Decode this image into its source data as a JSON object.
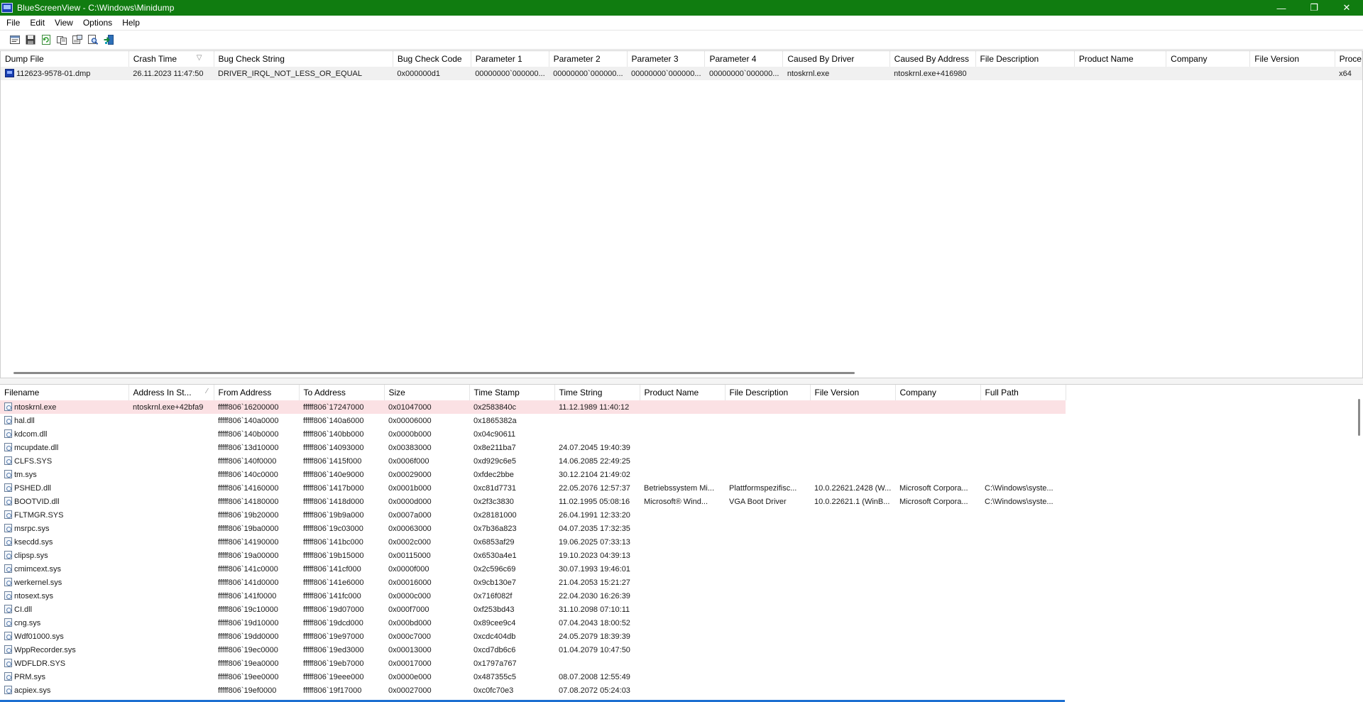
{
  "window": {
    "title": "BlueScreenView  -  C:\\Windows\\Minidump",
    "minimize": "—",
    "restore": "❐",
    "close": "✕"
  },
  "menu": [
    "File",
    "Edit",
    "View",
    "Options",
    "Help"
  ],
  "toolbar": {
    "icons": [
      "properties-icon",
      "save-icon",
      "refresh-icon",
      "copy-icon",
      "html-report-icon",
      "find-icon",
      "exit-icon"
    ]
  },
  "dumps": {
    "columns": [
      "Dump File",
      "Crash Time",
      "Bug Check String",
      "Bug Check Code",
      "Parameter 1",
      "Parameter 2",
      "Parameter 3",
      "Parameter 4",
      "Caused By Driver",
      "Caused By Address",
      "File Description",
      "Product Name",
      "Company",
      "File Version",
      "Proce"
    ],
    "sort_indicator": "▽",
    "rows": [
      [
        "112623-9578-01.dmp",
        "26.11.2023 11:47:50",
        "DRIVER_IRQL_NOT_LESS_OR_EQUAL",
        "0x000000d1",
        "00000000`000000...",
        "00000000`000000...",
        "00000000`000000...",
        "00000000`000000...",
        "ntoskrnl.exe",
        "ntoskrnl.exe+416980",
        "",
        "",
        "",
        "",
        "x64"
      ]
    ]
  },
  "modules": {
    "columns": [
      "Filename",
      "Address In St...",
      "From Address",
      "To Address",
      "Size",
      "Time Stamp",
      "Time String",
      "Product Name",
      "File Description",
      "File Version",
      "Company",
      "Full Path"
    ],
    "sort_indicator": "⁄",
    "rows": [
      [
        "ntoskrnl.exe",
        "ntoskrnl.exe+42bfa9",
        "fffff806`16200000",
        "fffff806`17247000",
        "0x01047000",
        "0x2583840c",
        "11.12.1989 11:40:12",
        "",
        "",
        "",
        "",
        ""
      ],
      [
        "hal.dll",
        "",
        "fffff806`140a0000",
        "fffff806`140a6000",
        "0x00006000",
        "0x1865382a",
        "",
        "",
        "",
        "",
        "",
        ""
      ],
      [
        "kdcom.dll",
        "",
        "fffff806`140b0000",
        "fffff806`140bb000",
        "0x0000b000",
        "0x04c90611",
        "",
        "",
        "",
        "",
        "",
        ""
      ],
      [
        "mcupdate.dll",
        "",
        "fffff806`13d10000",
        "fffff806`14093000",
        "0x00383000",
        "0x8e211ba7",
        "24.07.2045 19:40:39",
        "",
        "",
        "",
        "",
        ""
      ],
      [
        "CLFS.SYS",
        "",
        "fffff806`140f0000",
        "fffff806`1415f000",
        "0x0006f000",
        "0xd929c6e5",
        "14.06.2085 22:49:25",
        "",
        "",
        "",
        "",
        ""
      ],
      [
        "tm.sys",
        "",
        "fffff806`140c0000",
        "fffff806`140e9000",
        "0x00029000",
        "0xfdec2bbe",
        "30.12.2104 21:49:02",
        "",
        "",
        "",
        "",
        ""
      ],
      [
        "PSHED.dll",
        "",
        "fffff806`14160000",
        "fffff806`1417b000",
        "0x0001b000",
        "0xc81d7731",
        "22.05.2076 12:57:37",
        "Betriebssystem Mi...",
        "Plattformspezifisc...",
        "10.0.22621.2428 (W...",
        "Microsoft Corpora...",
        "C:\\Windows\\syste..."
      ],
      [
        "BOOTVID.dll",
        "",
        "fffff806`14180000",
        "fffff806`1418d000",
        "0x0000d000",
        "0x2f3c3830",
        "11.02.1995 05:08:16",
        "Microsoft® Wind...",
        "VGA Boot Driver",
        "10.0.22621.1 (WinB...",
        "Microsoft Corpora...",
        "C:\\Windows\\syste..."
      ],
      [
        "FLTMGR.SYS",
        "",
        "fffff806`19b20000",
        "fffff806`19b9a000",
        "0x0007a000",
        "0x28181000",
        "26.04.1991 12:33:20",
        "",
        "",
        "",
        "",
        ""
      ],
      [
        "msrpc.sys",
        "",
        "fffff806`19ba0000",
        "fffff806`19c03000",
        "0x00063000",
        "0x7b36a823",
        "04.07.2035 17:32:35",
        "",
        "",
        "",
        "",
        ""
      ],
      [
        "ksecdd.sys",
        "",
        "fffff806`14190000",
        "fffff806`141bc000",
        "0x0002c000",
        "0x6853af29",
        "19.06.2025 07:33:13",
        "",
        "",
        "",
        "",
        ""
      ],
      [
        "clipsp.sys",
        "",
        "fffff806`19a00000",
        "fffff806`19b15000",
        "0x00115000",
        "0x6530a4e1",
        "19.10.2023 04:39:13",
        "",
        "",
        "",
        "",
        ""
      ],
      [
        "cmimcext.sys",
        "",
        "fffff806`141c0000",
        "fffff806`141cf000",
        "0x0000f000",
        "0x2c596c69",
        "30.07.1993 19:46:01",
        "",
        "",
        "",
        "",
        ""
      ],
      [
        "werkernel.sys",
        "",
        "fffff806`141d0000",
        "fffff806`141e6000",
        "0x00016000",
        "0x9cb130e7",
        "21.04.2053 15:21:27",
        "",
        "",
        "",
        "",
        ""
      ],
      [
        "ntosext.sys",
        "",
        "fffff806`141f0000",
        "fffff806`141fc000",
        "0x0000c000",
        "0x716f082f",
        "22.04.2030 16:26:39",
        "",
        "",
        "",
        "",
        ""
      ],
      [
        "CI.dll",
        "",
        "fffff806`19c10000",
        "fffff806`19d07000",
        "0x000f7000",
        "0xf253bd43",
        "31.10.2098 07:10:11",
        "",
        "",
        "",
        "",
        ""
      ],
      [
        "cng.sys",
        "",
        "fffff806`19d10000",
        "fffff806`19dcd000",
        "0x000bd000",
        "0x89cee9c4",
        "07.04.2043 18:00:52",
        "",
        "",
        "",
        "",
        ""
      ],
      [
        "Wdf01000.sys",
        "",
        "fffff806`19dd0000",
        "fffff806`19e97000",
        "0x000c7000",
        "0xcdc404db",
        "24.05.2079 18:39:39",
        "",
        "",
        "",
        "",
        ""
      ],
      [
        "WppRecorder.sys",
        "",
        "fffff806`19ec0000",
        "fffff806`19ed3000",
        "0x00013000",
        "0xcd7db6c6",
        "01.04.2079 10:47:50",
        "",
        "",
        "",
        "",
        ""
      ],
      [
        "WDFLDR.SYS",
        "",
        "fffff806`19ea0000",
        "fffff806`19eb7000",
        "0x00017000",
        "0x1797a767",
        "",
        "",
        "",
        "",
        "",
        ""
      ],
      [
        "PRM.sys",
        "",
        "fffff806`19ee0000",
        "fffff806`19eee000",
        "0x0000e000",
        "0x487355c5",
        "08.07.2008 12:55:49",
        "",
        "",
        "",
        "",
        ""
      ],
      [
        "acpiex.sys",
        "",
        "fffff806`19ef0000",
        "fffff806`19f17000",
        "0x00027000",
        "0xc0fc70e3",
        "07.08.2072 05:24:03",
        "",
        "",
        "",
        "",
        ""
      ]
    ]
  }
}
